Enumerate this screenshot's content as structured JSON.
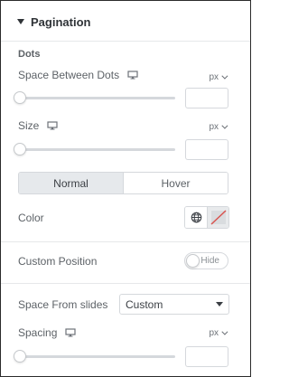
{
  "section": {
    "title": "Pagination"
  },
  "dots": {
    "heading": "Dots",
    "space_between": {
      "label": "Space Between Dots",
      "unit": "px",
      "value": ""
    },
    "size": {
      "label": "Size",
      "unit": "px",
      "value": ""
    }
  },
  "state_tabs": [
    {
      "label": "Normal",
      "active": true
    },
    {
      "label": "Hover",
      "active": false
    }
  ],
  "color": {
    "label": "Color",
    "global_icon": "globe-icon",
    "swatch_icon": "no-color-swatch-icon"
  },
  "custom_position": {
    "label": "Custom Position",
    "toggle_label": "Hide",
    "enabled": false
  },
  "space_from_slides": {
    "label": "Space From slides",
    "selected": "Custom"
  },
  "spacing": {
    "label": "Spacing",
    "unit": "px",
    "value": ""
  },
  "colors": {
    "accent_red": "#d9534f",
    "border": "#d5d8dc",
    "tab_active_bg": "#e6e9ec"
  }
}
